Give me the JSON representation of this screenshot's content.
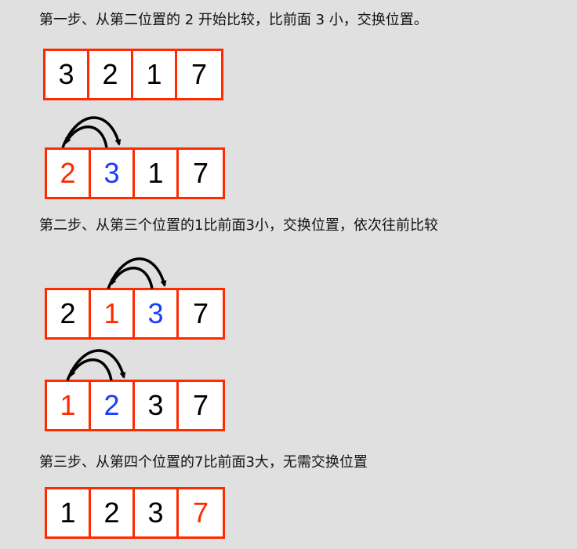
{
  "colors": {
    "background": "#e0e0e0",
    "cell_border": "#ff2a00",
    "cell_fill": "#ffffff",
    "default_digit": "#000000",
    "highlight_red": "#ff2a00",
    "highlight_blue": "#1a3cff",
    "arrow": "#000000"
  },
  "steps": [
    {
      "title": "第一步、从第二位置的 2 开始比较，比前面 3 小，交换位置。"
    },
    {
      "title": "第二步、从第三个位置的1比前面3小，交换位置，依次往前比较"
    },
    {
      "title": "第三步、从第四个位置的7比前面3大，无需交换位置"
    }
  ],
  "arrays": [
    {
      "name": "step1-before",
      "cells": [
        {
          "value": "3",
          "color": "default"
        },
        {
          "value": "2",
          "color": "default"
        },
        {
          "value": "1",
          "color": "default"
        },
        {
          "value": "7",
          "color": "default"
        }
      ]
    },
    {
      "name": "step1-after",
      "cells": [
        {
          "value": "2",
          "color": "red"
        },
        {
          "value": "3",
          "color": "blue"
        },
        {
          "value": "1",
          "color": "default"
        },
        {
          "value": "7",
          "color": "default"
        }
      ]
    },
    {
      "name": "step2-first-swap",
      "cells": [
        {
          "value": "2",
          "color": "default"
        },
        {
          "value": "1",
          "color": "red"
        },
        {
          "value": "3",
          "color": "blue"
        },
        {
          "value": "7",
          "color": "default"
        }
      ]
    },
    {
      "name": "step2-second-swap",
      "cells": [
        {
          "value": "1",
          "color": "red"
        },
        {
          "value": "2",
          "color": "blue"
        },
        {
          "value": "3",
          "color": "default"
        },
        {
          "value": "7",
          "color": "default"
        }
      ]
    },
    {
      "name": "step3-result",
      "cells": [
        {
          "value": "1",
          "color": "default"
        },
        {
          "value": "2",
          "color": "default"
        },
        {
          "value": "3",
          "color": "default"
        },
        {
          "value": "7",
          "color": "red"
        }
      ]
    }
  ]
}
